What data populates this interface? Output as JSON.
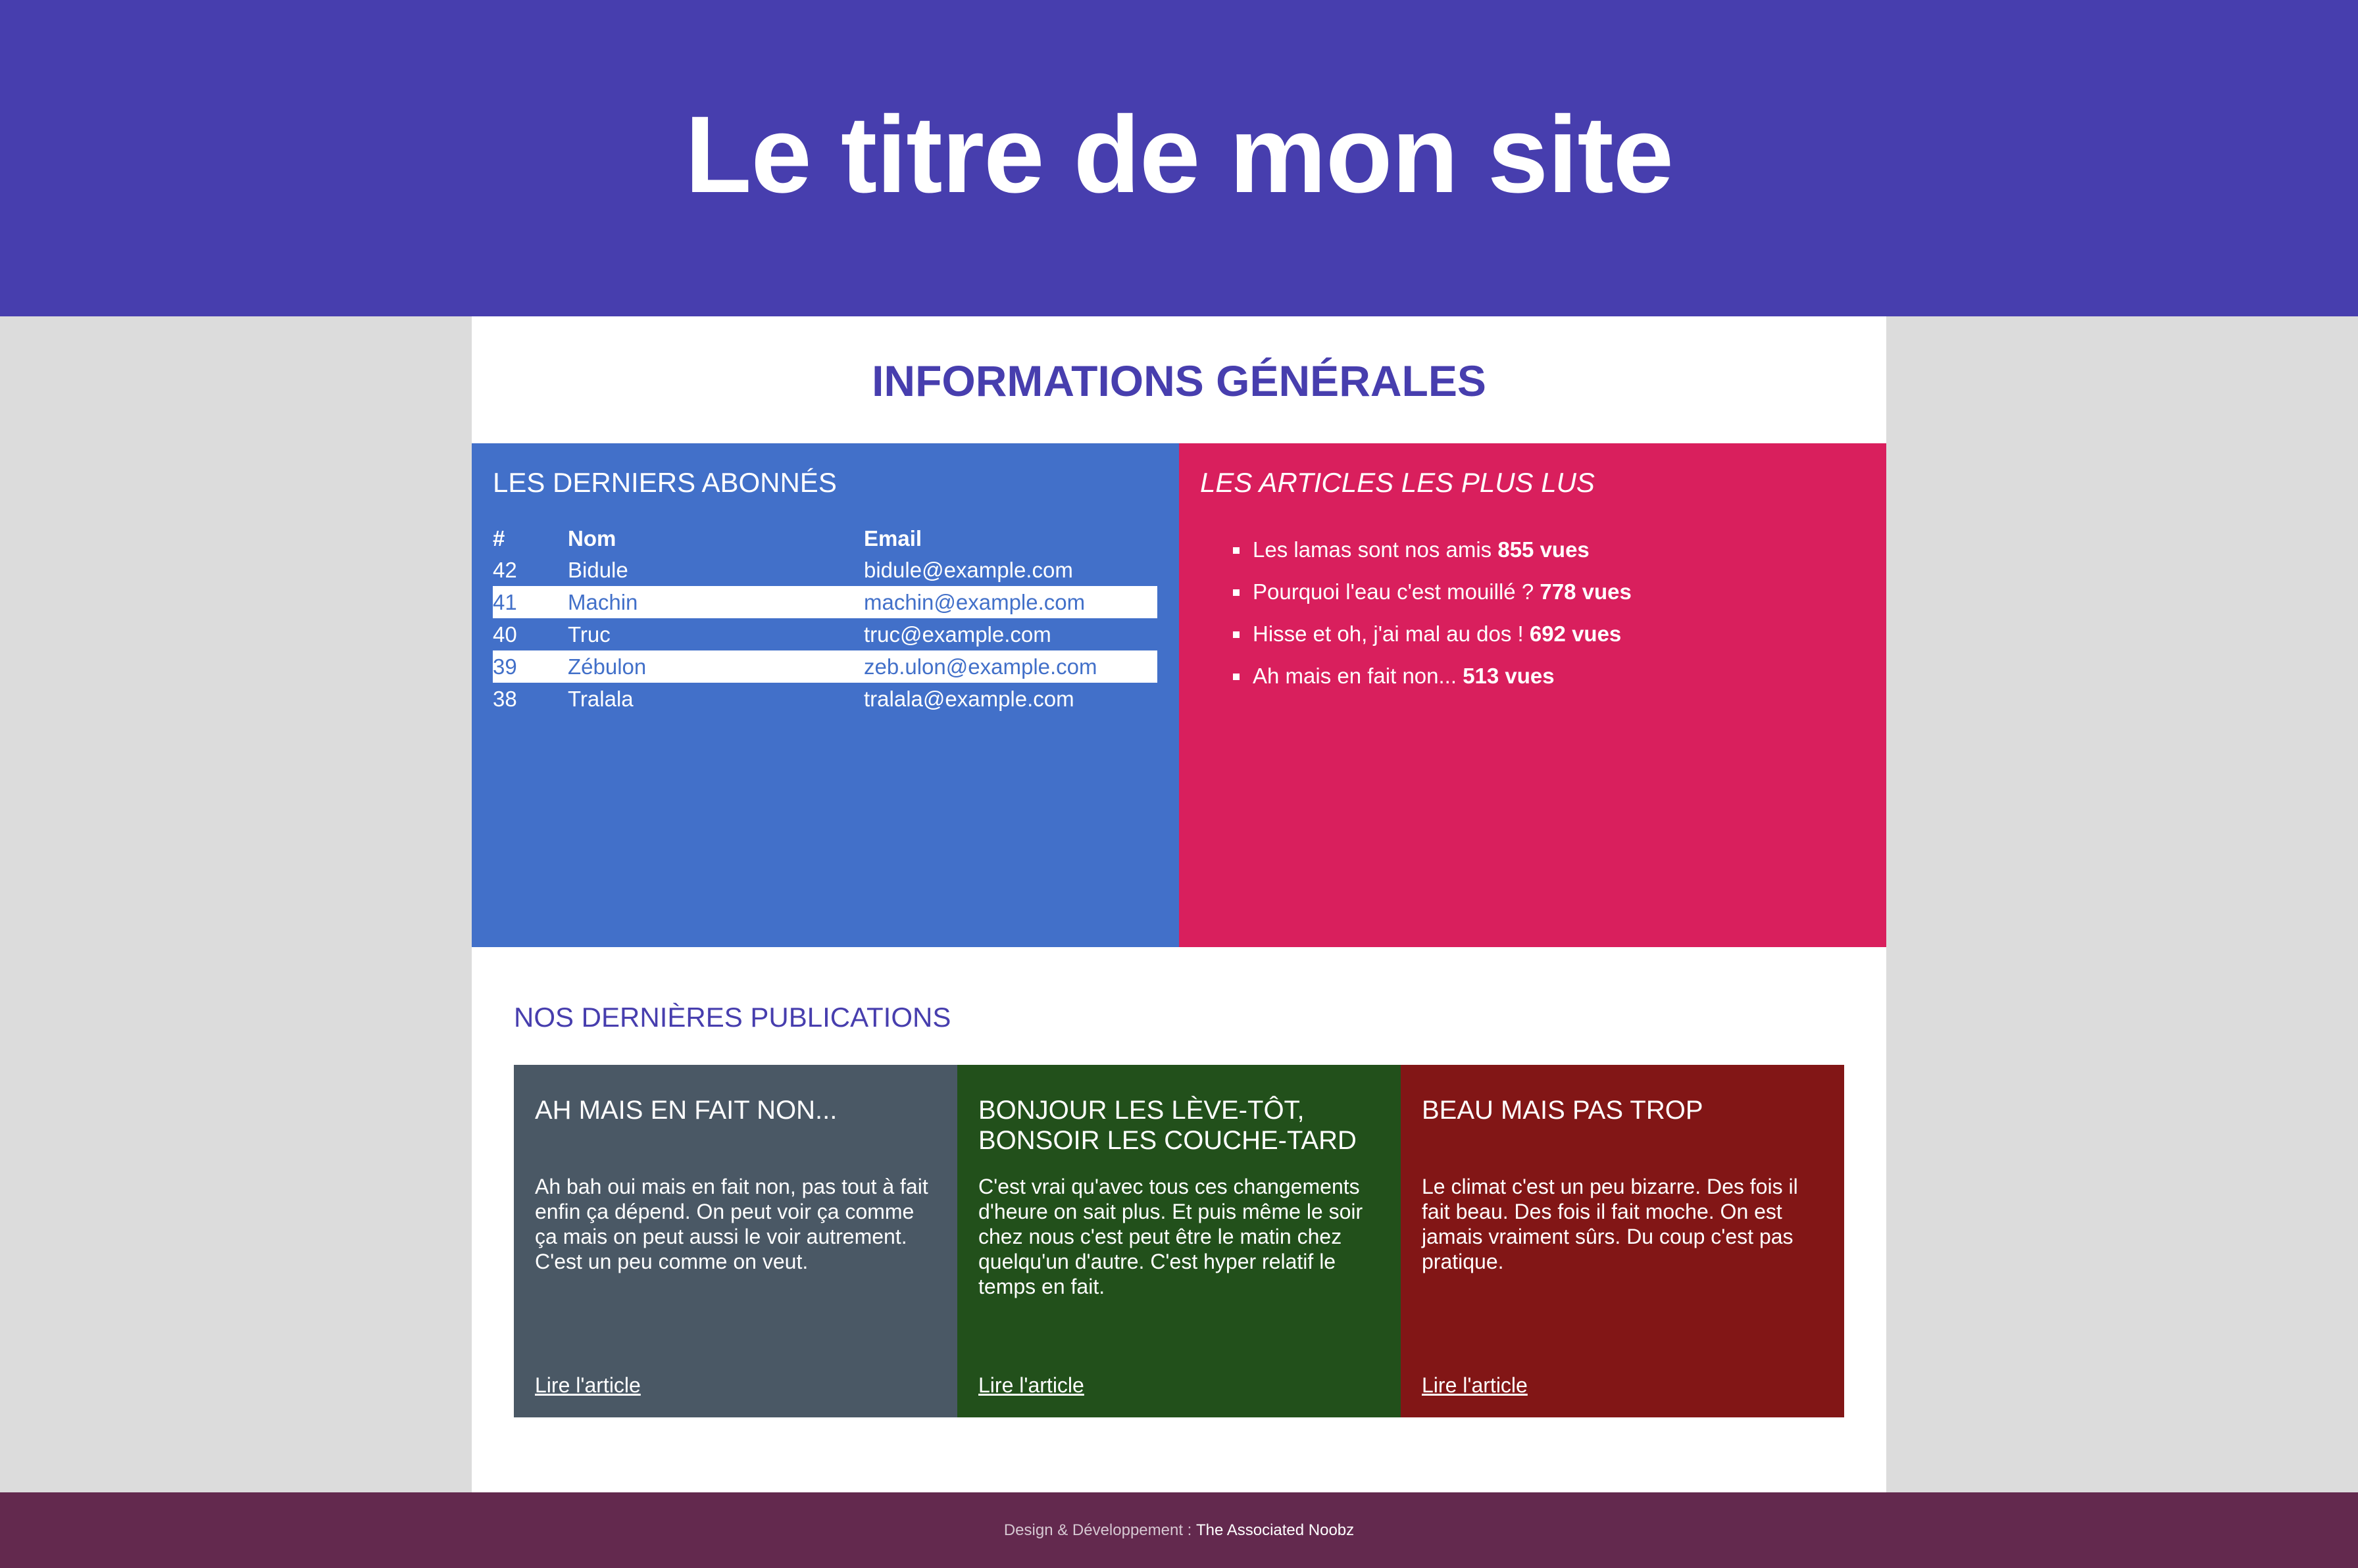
{
  "header": {
    "title": "Le titre de mon site",
    "background": "#473eae"
  },
  "info": {
    "title": "INFORMATIONS GÉNÉRALES",
    "subscribers": {
      "heading": "LES DERNIERS ABONNÉS",
      "columns": [
        "#",
        "Nom",
        "Email"
      ],
      "rows": [
        {
          "num": "42",
          "name": "Bidule",
          "email": "bidule@example.com"
        },
        {
          "num": "41",
          "name": "Machin",
          "email": "machin@example.com"
        },
        {
          "num": "40",
          "name": "Truc",
          "email": "truc@example.com"
        },
        {
          "num": "39",
          "name": "Zébulon",
          "email": "zeb.ulon@example.com"
        },
        {
          "num": "38",
          "name": "Tralala",
          "email": "tralala@example.com"
        }
      ],
      "background": "#4270c9"
    },
    "articles": {
      "heading": "LES ARTICLES LES PLUS LUS",
      "items": [
        {
          "title": "Les lamas sont nos amis",
          "views": "855 vues"
        },
        {
          "title": "Pourquoi l'eau c'est mouillé ?",
          "views": "778 vues"
        },
        {
          "title": "Hisse et oh, j'ai mal au dos !",
          "views": "692 vues"
        },
        {
          "title": "Ah mais en fait non...",
          "views": "513 vues"
        }
      ],
      "background": "#d91f5d"
    }
  },
  "publications": {
    "title": "NOS DERNIÈRES PUBLICATIONS",
    "cards": [
      {
        "title": "AH MAIS EN FAIT NON...",
        "text": "Ah bah oui mais en fait non, pas tout à fait enfin ça dépend. On peut voir ça comme ça mais on peut aussi le voir autrement. C'est un peu comme on veut.",
        "link": "Lire l'article",
        "color": "#4a5865"
      },
      {
        "title": "BONJOUR LES LÈVE-TÔT, BONSOIR LES COUCHE-TARD",
        "text": "C'est vrai qu'avec tous ces changements d'heure on sait plus. Et puis même le soir chez nous c'est peut être le matin chez quelqu'un d'autre. C'est hyper relatif le temps en fait.",
        "link": "Lire l'article",
        "color": "#22501b"
      },
      {
        "title": "BEAU MAIS PAS TROP",
        "text": "Le climat c'est un peu bizarre. Des fois il fait beau. Des fois il fait moche. On est jamais vraiment sûrs. Du coup c'est pas pratique.",
        "link": "Lire l'article",
        "color": "#821616"
      }
    ]
  },
  "footer": {
    "prefix": "Design & Développement : ",
    "credit": "The Associated Noobz",
    "background": "#63294e"
  }
}
